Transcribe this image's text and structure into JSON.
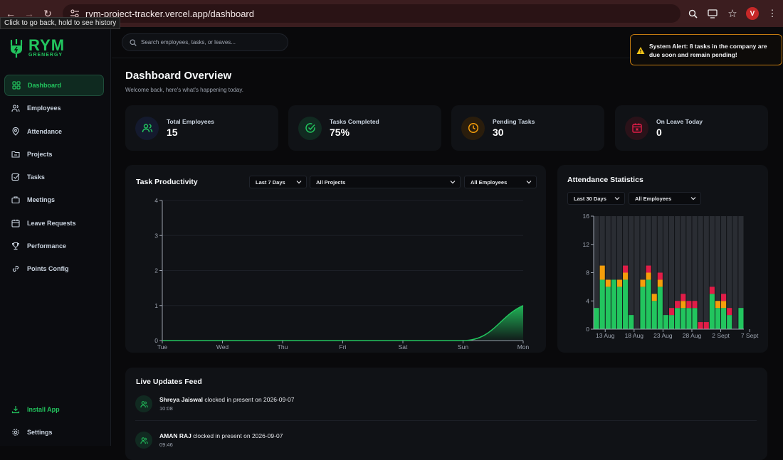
{
  "browser": {
    "url": "rym-project-tracker.vercel.app/dashboard",
    "tooltip": "Click to go back, hold to see history",
    "profile_initial": "V"
  },
  "sidebar": {
    "logo_title": "RYM",
    "logo_sub": "GRENERGY",
    "items": [
      {
        "label": "Dashboard",
        "icon": "dashboard-icon",
        "active": true
      },
      {
        "label": "Employees",
        "icon": "users-icon"
      },
      {
        "label": "Attendance",
        "icon": "location-pin-icon"
      },
      {
        "label": "Projects",
        "icon": "folder-icon"
      },
      {
        "label": "Tasks",
        "icon": "check-square-icon"
      },
      {
        "label": "Meetings",
        "icon": "briefcase-icon"
      },
      {
        "label": "Leave Requests",
        "icon": "calendar-icon"
      },
      {
        "label": "Performance",
        "icon": "trophy-icon"
      },
      {
        "label": "Points Config",
        "icon": "link-icon"
      }
    ],
    "install_label": "Install App",
    "settings_label": "Settings"
  },
  "search": {
    "placeholder": "Search employees, tasks, or leaves..."
  },
  "alert": {
    "text": "System Alert: 8 tasks in the company are due soon and remain pending!"
  },
  "header": {
    "title": "Dashboard Overview",
    "subtitle": "Welcome back, here's what's happening today."
  },
  "stats": [
    {
      "label": "Total Employees",
      "value": "15",
      "color": "#22c55e"
    },
    {
      "label": "Tasks Completed",
      "value": "75%",
      "color": "#22c55e"
    },
    {
      "label": "Pending Tasks",
      "value": "30",
      "color": "#f59e0b"
    },
    {
      "label": "On Leave Today",
      "value": "0",
      "color": "#e11d48"
    }
  ],
  "productivity": {
    "title": "Task Productivity",
    "filters": {
      "range": "Last 7 Days",
      "project": "All Projects",
      "employee": "All Employees"
    }
  },
  "attendance": {
    "title": "Attendance Statistics",
    "filters": {
      "range": "Last 30 Days",
      "employee": "All Employees"
    }
  },
  "chart_data": [
    {
      "type": "area",
      "title": "Task Productivity",
      "categories": [
        "Tue",
        "Wed",
        "Thu",
        "Fri",
        "Sat",
        "Sun",
        "Mon"
      ],
      "values": [
        0,
        0,
        0,
        0,
        0,
        0,
        1
      ],
      "ylim": [
        0,
        4
      ],
      "yticks": [
        0,
        1,
        2,
        3,
        4
      ],
      "color": "#22c55e"
    },
    {
      "type": "bar",
      "stacked": true,
      "title": "Attendance Statistics",
      "tick_labels": [
        "13 Aug",
        "18 Aug",
        "23 Aug",
        "28 Aug",
        "2 Sept",
        "7 Sept"
      ],
      "ylim": [
        0,
        16
      ],
      "yticks": [
        0,
        4,
        8,
        12,
        16
      ],
      "colors": [
        "#22c55e",
        "#f59e0b",
        "#e11d48"
      ],
      "series": [
        {
          "values": [
            3,
            7,
            6,
            7,
            6,
            7,
            2,
            0,
            6,
            7,
            4,
            6,
            2,
            2,
            3,
            3,
            3,
            3,
            0,
            0,
            5,
            3,
            3,
            2,
            0,
            3
          ]
        },
        {
          "values": [
            0,
            2,
            1,
            0,
            1,
            1,
            0,
            0,
            1,
            1,
            1,
            1,
            0,
            0,
            0,
            1,
            0,
            0,
            0,
            0,
            0,
            1,
            1,
            0,
            0,
            0
          ]
        },
        {
          "values": [
            0,
            0,
            0,
            0,
            0,
            1,
            0,
            0,
            0,
            1,
            0,
            1,
            0,
            1,
            1,
            1,
            1,
            1,
            1,
            1,
            1,
            0,
            1,
            1,
            0,
            0
          ]
        }
      ]
    }
  ],
  "feed": {
    "title": "Live Updates Feed",
    "items": [
      {
        "name": "Shreya Jaiswal",
        "text": "clocked in present on 2026-09-07",
        "time": "10:08"
      },
      {
        "name": "AMAN RAJ",
        "text": "clocked in present on 2026-09-07",
        "time": "09:46"
      }
    ]
  }
}
